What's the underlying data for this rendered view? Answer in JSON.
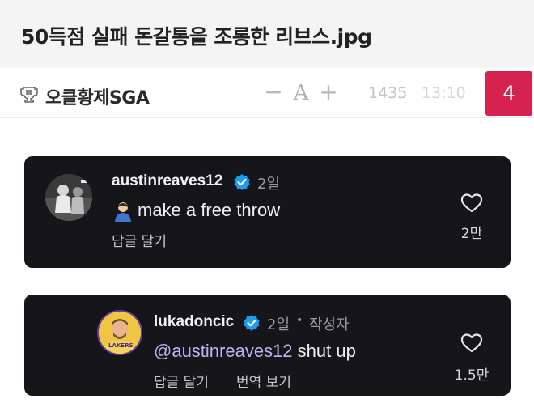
{
  "post": {
    "title": "50득점 실패 돈갈통을 조롱한 리브스.jpg",
    "author": "오클황제SGA",
    "author_icon": "trophy-icon",
    "zoom_minus": "−",
    "zoom_label": "A",
    "zoom_plus": "+",
    "views": "1435",
    "time": "13:10",
    "comment_count": "4",
    "badge_color": "#d5224f"
  },
  "comments": [
    {
      "username": "austinreaves12",
      "verified": true,
      "time": "2일",
      "emoji": "person-emoji",
      "text": "make a free throw",
      "reply_label": "답글 달기",
      "likes": "2만"
    },
    {
      "username": "lukadoncic",
      "verified": true,
      "time": "2일",
      "separator": "•",
      "op_tag": "작성자",
      "mention": "@austinreaves12",
      "text": " shut up",
      "reply_label": "답글 달기",
      "translate_label": "번역 보기",
      "likes": "1.5만"
    }
  ],
  "colors": {
    "card_bg": "#16161a",
    "mention": "#b9b4f2",
    "verified": "#1d9bf0"
  }
}
